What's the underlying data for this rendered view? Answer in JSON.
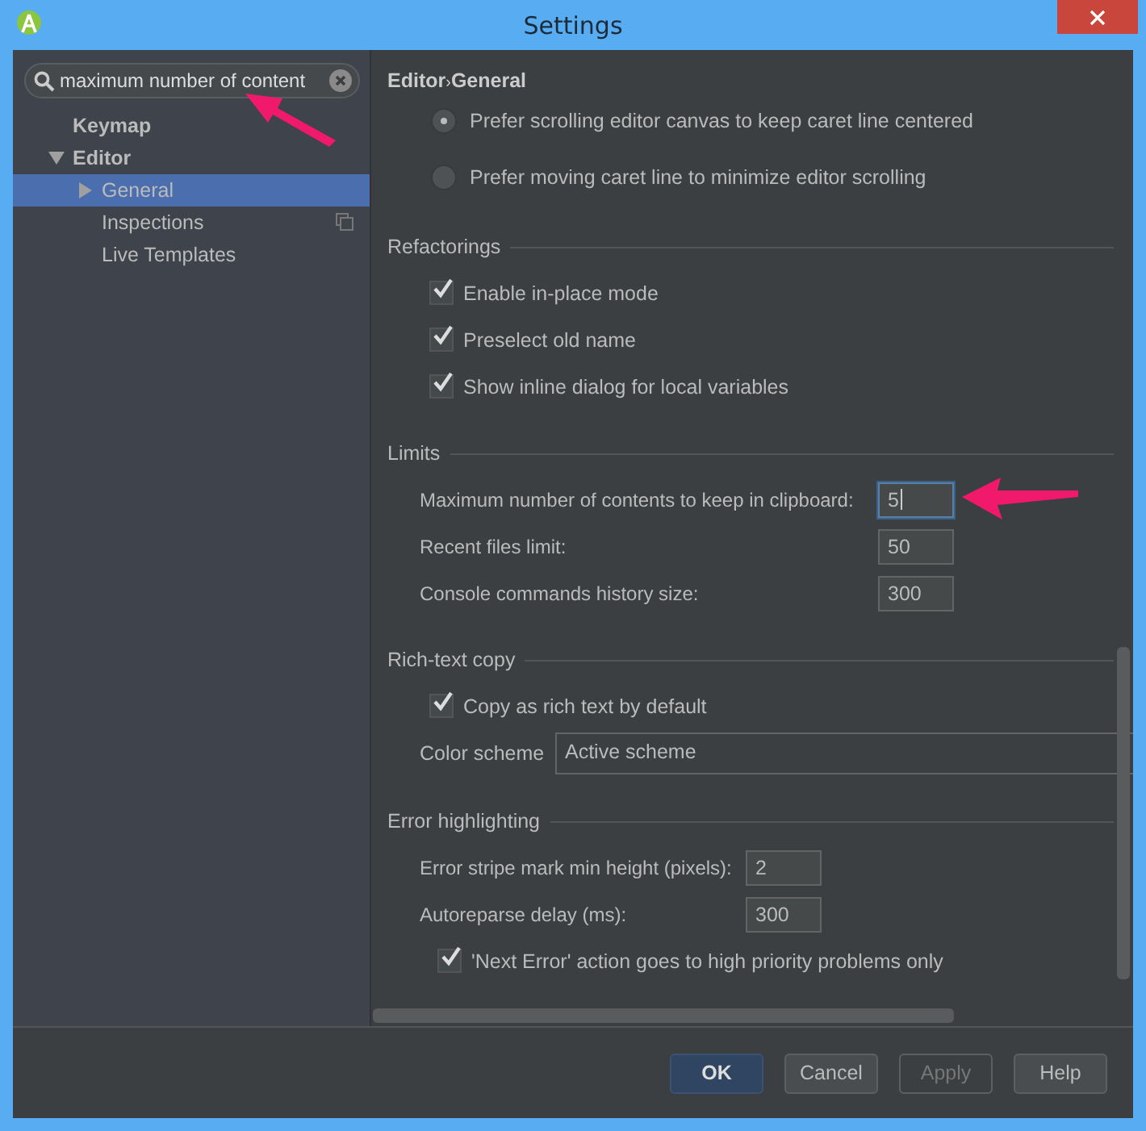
{
  "window": {
    "title": "Settings"
  },
  "search": {
    "value": "maximum number of content"
  },
  "tree": [
    {
      "label": "Keymap",
      "matched": true,
      "selected": false
    },
    {
      "label": "Editor",
      "matched": true,
      "selected": false,
      "expanded": true,
      "children": [
        {
          "label": "General",
          "matched": false,
          "selected": true,
          "expanded": false
        },
        {
          "label": "Inspections",
          "matched": false,
          "selected": false,
          "project_icon": true
        },
        {
          "label": "Live Templates",
          "matched": false,
          "selected": false
        }
      ]
    }
  ],
  "breadcrumb": [
    "Editor",
    "General"
  ],
  "breadcrumb_separator": "›",
  "sections": [
    {
      "rows": [
        {
          "kind": "radio",
          "label": "Prefer scrolling editor canvas to keep caret line centered",
          "selected": true
        },
        {
          "kind": "radio",
          "label": "Prefer moving caret line to minimize editor scrolling",
          "selected": false
        }
      ]
    },
    {
      "title": "Refactorings",
      "rows": [
        {
          "kind": "checkbox",
          "label": "Enable in-place mode",
          "checked": true
        },
        {
          "kind": "checkbox",
          "label": "Preselect old name",
          "checked": true
        },
        {
          "kind": "checkbox",
          "label": "Show inline dialog for local variables",
          "checked": true
        }
      ]
    },
    {
      "title": "Limits",
      "rows": [
        {
          "kind": "number",
          "label": "Maximum number of contents to keep in clipboard:",
          "value": "5",
          "focused": true
        },
        {
          "kind": "number",
          "label": "Recent files limit:",
          "value": "50",
          "focused": false
        },
        {
          "kind": "number",
          "label": "Console commands history size:",
          "value": "300",
          "focused": false
        }
      ]
    },
    {
      "title": "Rich-text copy",
      "rows": [
        {
          "kind": "checkbox",
          "label": "Copy as rich text by default",
          "checked": true
        },
        {
          "kind": "combo",
          "label": "Color scheme",
          "value": "Active scheme"
        }
      ]
    },
    {
      "title": "Error highlighting",
      "rows": [
        {
          "kind": "number",
          "label": "Error stripe mark min height (pixels):",
          "value": "2",
          "focused": false,
          "short": true
        },
        {
          "kind": "number",
          "label": "Autoreparse delay (ms):",
          "value": "300",
          "focused": false,
          "short": true
        },
        {
          "kind": "checkbox",
          "label": "'Next Error' action goes to high priority problems only",
          "checked": true
        }
      ]
    }
  ],
  "buttons": [
    {
      "label": "OK",
      "default": true,
      "disabled": false
    },
    {
      "label": "Cancel",
      "default": false,
      "disabled": false
    },
    {
      "label": "Apply",
      "default": false,
      "disabled": true
    },
    {
      "label": "Help",
      "default": false,
      "disabled": false
    }
  ]
}
